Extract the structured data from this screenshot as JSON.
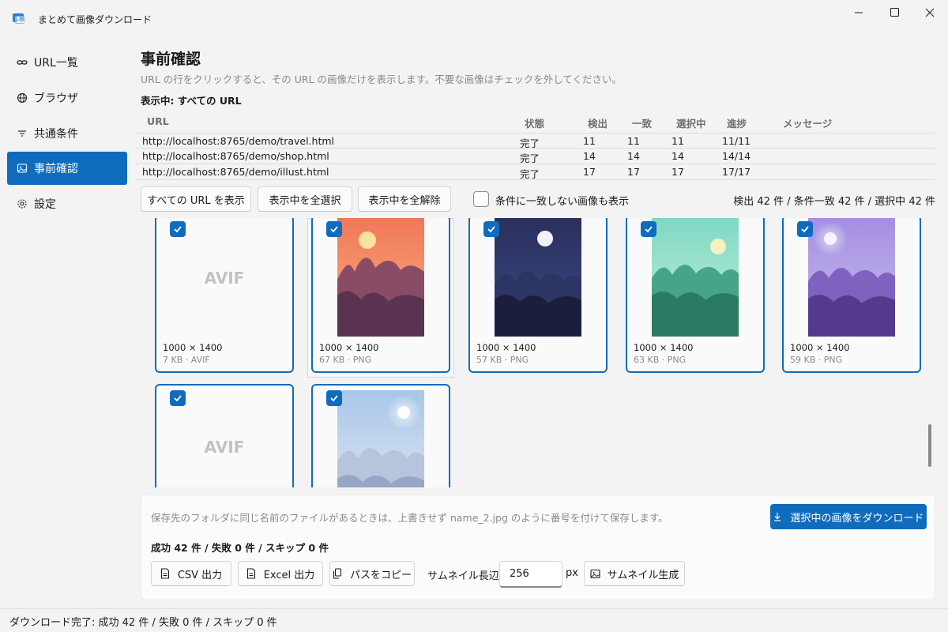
{
  "window": {
    "title": "まとめて画像ダウンロード"
  },
  "sidebar": {
    "items": [
      {
        "label": "URL一覧",
        "icon": "link-icon",
        "active": false
      },
      {
        "label": "ブラウザ",
        "icon": "globe-icon",
        "active": false
      },
      {
        "label": "共通条件",
        "icon": "filter-icon",
        "active": false
      },
      {
        "label": "事前確認",
        "icon": "image-icon",
        "active": true
      },
      {
        "label": "設定",
        "icon": "gear-icon",
        "active": false
      }
    ]
  },
  "page": {
    "title": "事前確認",
    "description": "URL の行をクリックすると、その URL の画像だけを表示します。不要な画像はチェックを外してください。",
    "showing": "表示中: すべての URL"
  },
  "table": {
    "headers": {
      "url": "URL",
      "status": "状態",
      "found": "検出",
      "match": "一致",
      "selected": "選択中",
      "progress": "進捗",
      "message": "メッセージ"
    },
    "rows": [
      {
        "url": "http://localhost:8765/demo/travel.html",
        "status": "完了",
        "found": "11",
        "match": "11",
        "selected": "11",
        "progress": "11/11",
        "message": ""
      },
      {
        "url": "http://localhost:8765/demo/shop.html",
        "status": "完了",
        "found": "14",
        "match": "14",
        "selected": "14",
        "progress": "14/14",
        "message": ""
      },
      {
        "url": "http://localhost:8765/demo/illust.html",
        "status": "完了",
        "found": "17",
        "match": "17",
        "selected": "17",
        "progress": "17/17",
        "message": ""
      }
    ]
  },
  "toolbar": {
    "show_all": "すべての URL を表示",
    "select_all": "表示中を全選択",
    "deselect_all": "表示中を全解除",
    "show_unmatched": "条件に一致しない画像も表示",
    "counts": "検出 42 件 / 条件一致 42 件 / 選択中 42 件"
  },
  "cards": [
    {
      "kind": "avif",
      "label": "AVIF",
      "dims": "1000 × 1400",
      "meta": "7 KB · AVIF",
      "checked": true
    },
    {
      "kind": "sunset",
      "dims": "1000 × 1400",
      "meta": "67 KB · PNG",
      "checked": true
    },
    {
      "kind": "night",
      "dims": "1000 × 1400",
      "meta": "57 KB · PNG",
      "checked": true
    },
    {
      "kind": "teal",
      "dims": "1000 × 1400",
      "meta": "63 KB · PNG",
      "checked": true
    },
    {
      "kind": "purple",
      "dims": "1000 × 1400",
      "meta": "59 KB · PNG",
      "checked": true
    },
    {
      "kind": "avif",
      "label": "AVIF",
      "checked": true
    },
    {
      "kind": "sky",
      "checked": true
    }
  ],
  "bottom": {
    "note": "保存先のフォルダに同じ名前のファイルがあるときは、上書きせず name_2.jpg のように番号を付けて保存します。",
    "download_label": "選択中の画像をダウンロード",
    "result": "成功 42 件 / 失敗 0 件 / スキップ 0 件",
    "csv_label": "CSV 出力",
    "excel_label": "Excel 出力",
    "copy_path_label": "パスをコピー",
    "thumb_size_label": "サムネイル長辺",
    "thumb_size_value": "256",
    "px_label": "px",
    "thumb_gen_label": "サムネイル生成"
  },
  "status": {
    "text": "ダウンロード完了: 成功 42 件 / 失敗 0 件 / スキップ 0 件"
  },
  "colors": {
    "accent": "#0f6cbd",
    "background": "#f3f3f3"
  }
}
